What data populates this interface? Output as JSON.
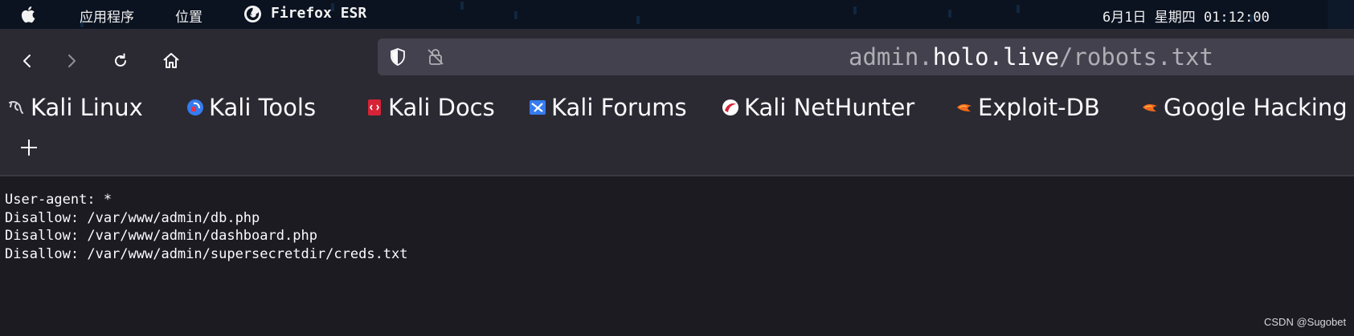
{
  "system_bar": {
    "apps_menu": "应用程序",
    "places_menu": "位置",
    "active_app": "Firefox ESR",
    "clock": "6月1日 星期四 01:12:00"
  },
  "browser": {
    "url": {
      "prefix": "admin.",
      "host": "holo.live",
      "path": "/robots.txt"
    },
    "bookmarks": [
      {
        "label": "Kali Linux",
        "icon": "kali-dragon-icon"
      },
      {
        "label": "Kali Tools",
        "icon": "kali-tools-icon"
      },
      {
        "label": "Kali Docs",
        "icon": "kali-docs-icon"
      },
      {
        "label": "Kali Forums",
        "icon": "kali-forums-icon"
      },
      {
        "label": "Kali NetHunter",
        "icon": "kali-nethunter-icon"
      },
      {
        "label": "Exploit-DB",
        "icon": "exploit-db-icon"
      },
      {
        "label": "Google Hacking",
        "icon": "exploit-db-icon"
      }
    ]
  },
  "page": {
    "lines": [
      "User-agent: *",
      "Disallow: /var/www/admin/db.php",
      "Disallow: /var/www/admin/dashboard.php",
      "Disallow: /var/www/admin/supersecretdir/creds.txt"
    ],
    "watermark": "CSDN @Sugobet"
  },
  "colors": {
    "chrome_bg": "#2b2a33",
    "page_bg": "#1c1b22",
    "urlbar_bg": "#42414d",
    "topbar_bg": "#0b1220"
  }
}
